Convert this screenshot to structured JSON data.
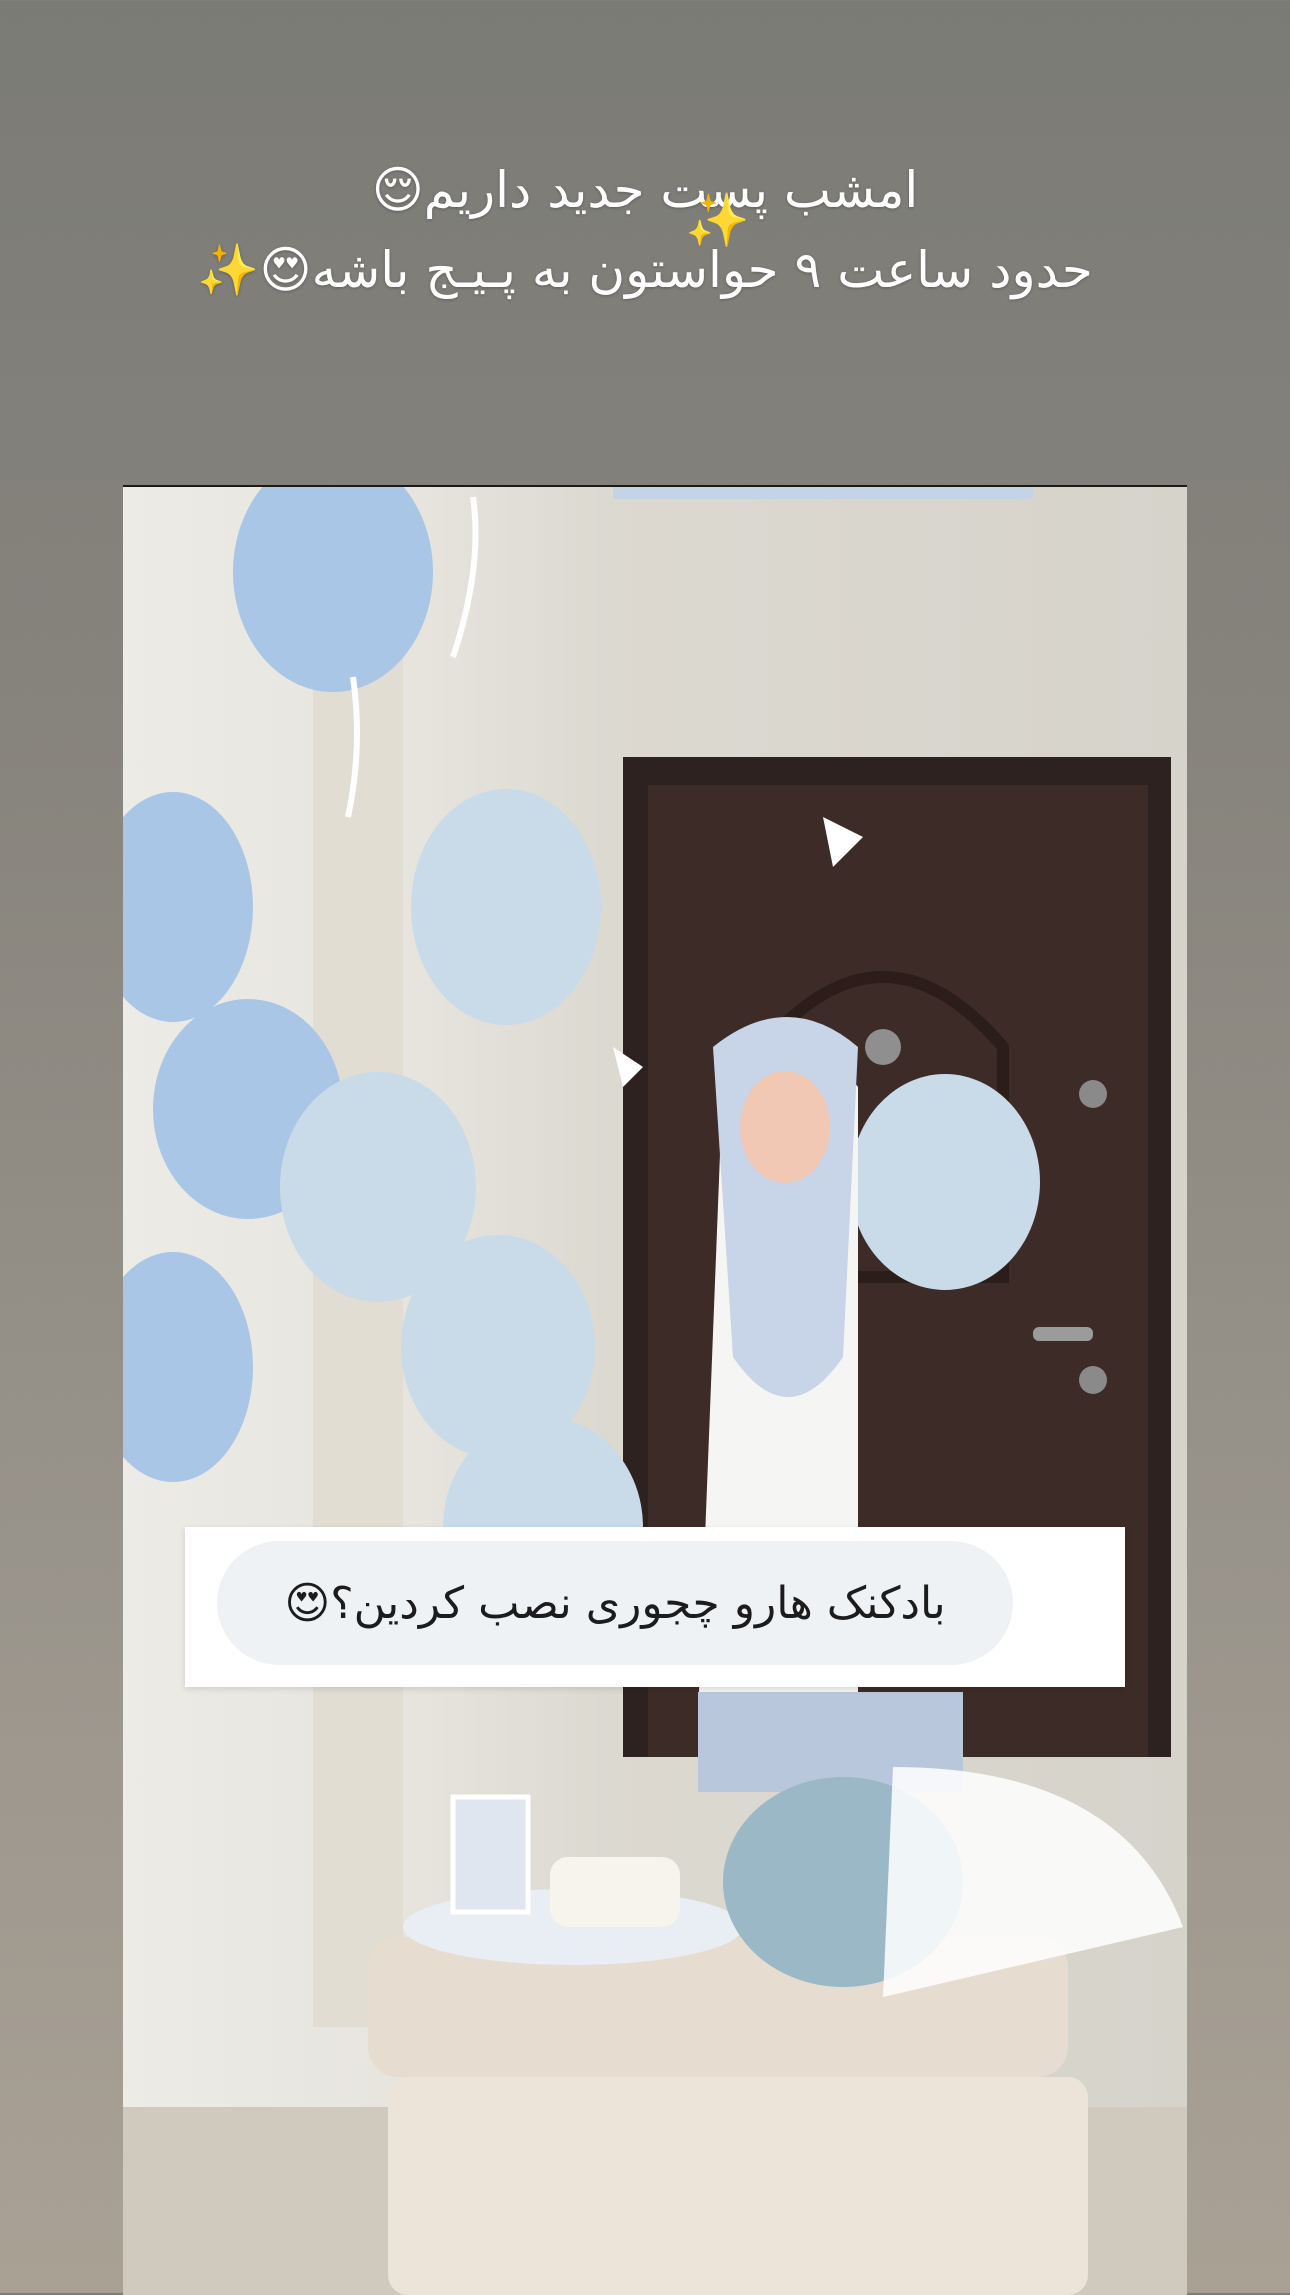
{
  "story": {
    "caption_line1": "امشب پست جدید داریم😌",
    "caption_line2": "حدود ساعت ۹ حواستون به پـیـج باشه😍✨",
    "sparkle_decoration": "✨"
  },
  "question_sticker": {
    "text": "بادکنک هارو چجوری نصب کردین؟😍"
  },
  "colors": {
    "background": "#86837c",
    "balloon_blue": "#a9c6e6",
    "balloon_light": "#c9dbe9",
    "door": "#3d2b27",
    "sticker_pill": "#eff2f4"
  }
}
